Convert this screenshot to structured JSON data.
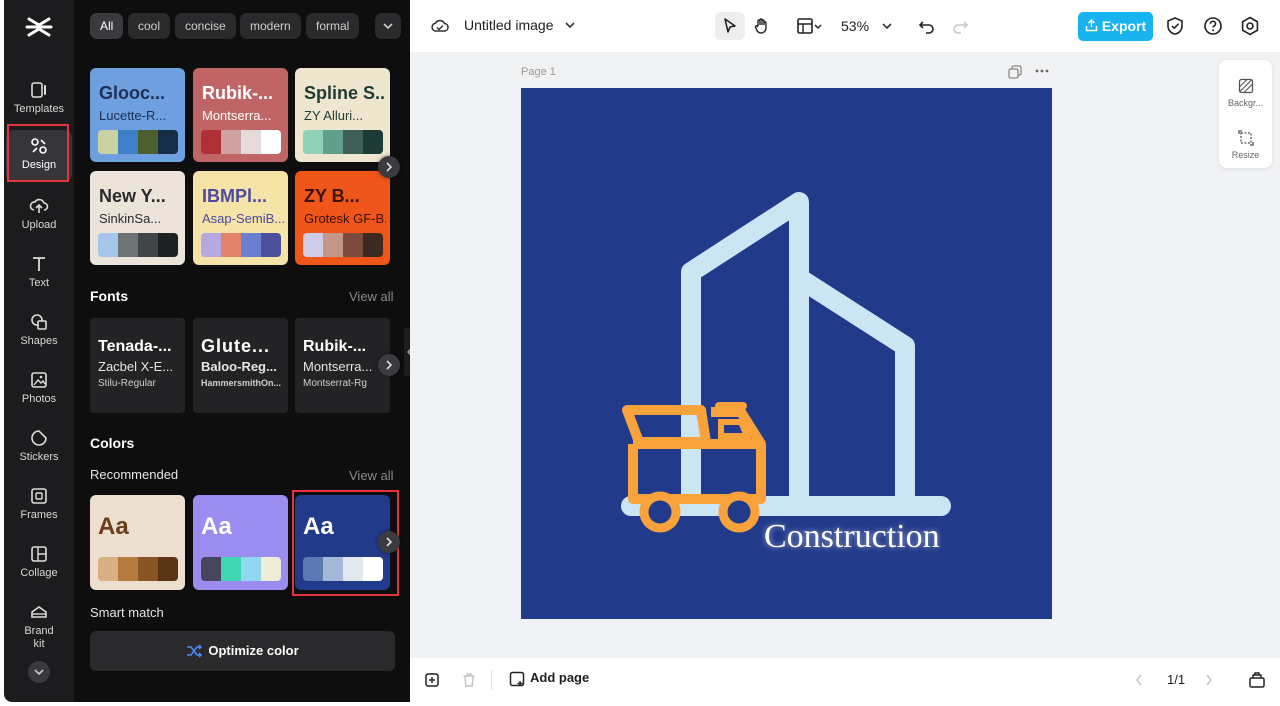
{
  "rail": {
    "items": [
      {
        "label": "Templates",
        "icon": "templates-icon"
      },
      {
        "label": "Design",
        "icon": "design-icon",
        "active": true
      },
      {
        "label": "Upload",
        "icon": "upload-icon"
      },
      {
        "label": "Text",
        "icon": "text-icon"
      },
      {
        "label": "Shapes",
        "icon": "shapes-icon"
      },
      {
        "label": "Photos",
        "icon": "photos-icon"
      },
      {
        "label": "Stickers",
        "icon": "stickers-icon"
      },
      {
        "label": "Frames",
        "icon": "frames-icon"
      },
      {
        "label": "Collage",
        "icon": "collage-icon"
      },
      {
        "label": "Brand kit",
        "icon": "brand-kit-icon"
      }
    ]
  },
  "filters": [
    "All",
    "cool",
    "concise",
    "modern",
    "formal"
  ],
  "themes": [
    {
      "title": "Glooc...",
      "sub": "Lucette-R...",
      "bg": "#6e9fdf",
      "fg": "#1d2f55",
      "swatches": [
        "#c9d3a2",
        "#3d7fc9",
        "#4d5e2f",
        "#172c46"
      ]
    },
    {
      "title": "Rubik-...",
      "sub": "Montserra...",
      "bg": "#c06565",
      "fg": "#ffffff",
      "swatches": [
        "#b02f35",
        "#cfa1a1",
        "#e5dada",
        "#ffffff"
      ]
    },
    {
      "title": "Spline S...",
      "sub": "ZY Alluri...",
      "bg": "#efe6cf",
      "fg": "#1f3b34",
      "swatches": [
        "#8fd2b8",
        "#5f9f8b",
        "#3f5e57",
        "#1d3b36"
      ]
    },
    {
      "title": "New Y...",
      "sub": "SinkinSa...",
      "bg": "#ece4da",
      "fg": "#2a2a2a",
      "swatches": [
        "#a5c6ea",
        "#6e7378",
        "#404548",
        "#1e2124"
      ]
    },
    {
      "title": "IBMPl...",
      "sub": "Asap-SemiB...",
      "bg": "#f6e3a8",
      "fg": "#4a4aa0",
      "swatches": [
        "#b6a8e0",
        "#e2826d",
        "#6a7fd0",
        "#4c4f9a"
      ]
    },
    {
      "title": "ZY B...",
      "sub": "Grotesk GF-B...",
      "bg": "#f0561a",
      "fg": "#3a1208",
      "swatches": [
        "#cfcce8",
        "#c2978a",
        "#7b4a3c",
        "#3b2a22"
      ]
    }
  ],
  "fonts_section": {
    "title": "Fonts",
    "view_all": "View all"
  },
  "fonts": [
    {
      "l1": "Tenada-...",
      "l2": "Zacbel X-E...",
      "l3": "Stilu-Regular"
    },
    {
      "l1": "Glute...",
      "l2": "Baloo-Reg...",
      "l3": "HammersmithOn..."
    },
    {
      "l1": "Rubik-...",
      "l2": "Montserra...",
      "l3": "Montserrat-Rg"
    }
  ],
  "colors_section": {
    "title": "Colors",
    "recommended": "Recommended",
    "view_all": "View all",
    "smart_match": "Smart match",
    "optimize": "Optimize color"
  },
  "palettes": [
    {
      "label": "Aa",
      "bg": "#ecdfd0",
      "fg": "#6b3d1e",
      "swatches": [
        "#d7b084",
        "#b57c3d",
        "#8a5525",
        "#5b3416"
      ]
    },
    {
      "label": "Aa",
      "bg": "#9b8cf0",
      "fg": "#ffffff",
      "swatches": [
        "#48465e",
        "#3ed7b2",
        "#8fd8ef",
        "#f0ecd8"
      ]
    },
    {
      "label": "Aa",
      "bg": "#223a8a",
      "fg": "#ffffff",
      "swatches": [
        "#5a79b0",
        "#a5b8d6",
        "#e2e8f0",
        "#ffffff"
      ],
      "selected": true
    }
  ],
  "toolbar": {
    "doc_title": "Untitled image",
    "zoom": "53%",
    "export": "Export"
  },
  "canvas": {
    "page_label": "Page 1",
    "art_text": "Construction",
    "art_bg": "#223a8a"
  },
  "side_tools": [
    {
      "label": "Backgr...",
      "icon": "background-icon"
    },
    {
      "label": "Resize",
      "icon": "resize-icon"
    }
  ],
  "bottom": {
    "add_page": "Add page",
    "page_count": "1/1"
  }
}
